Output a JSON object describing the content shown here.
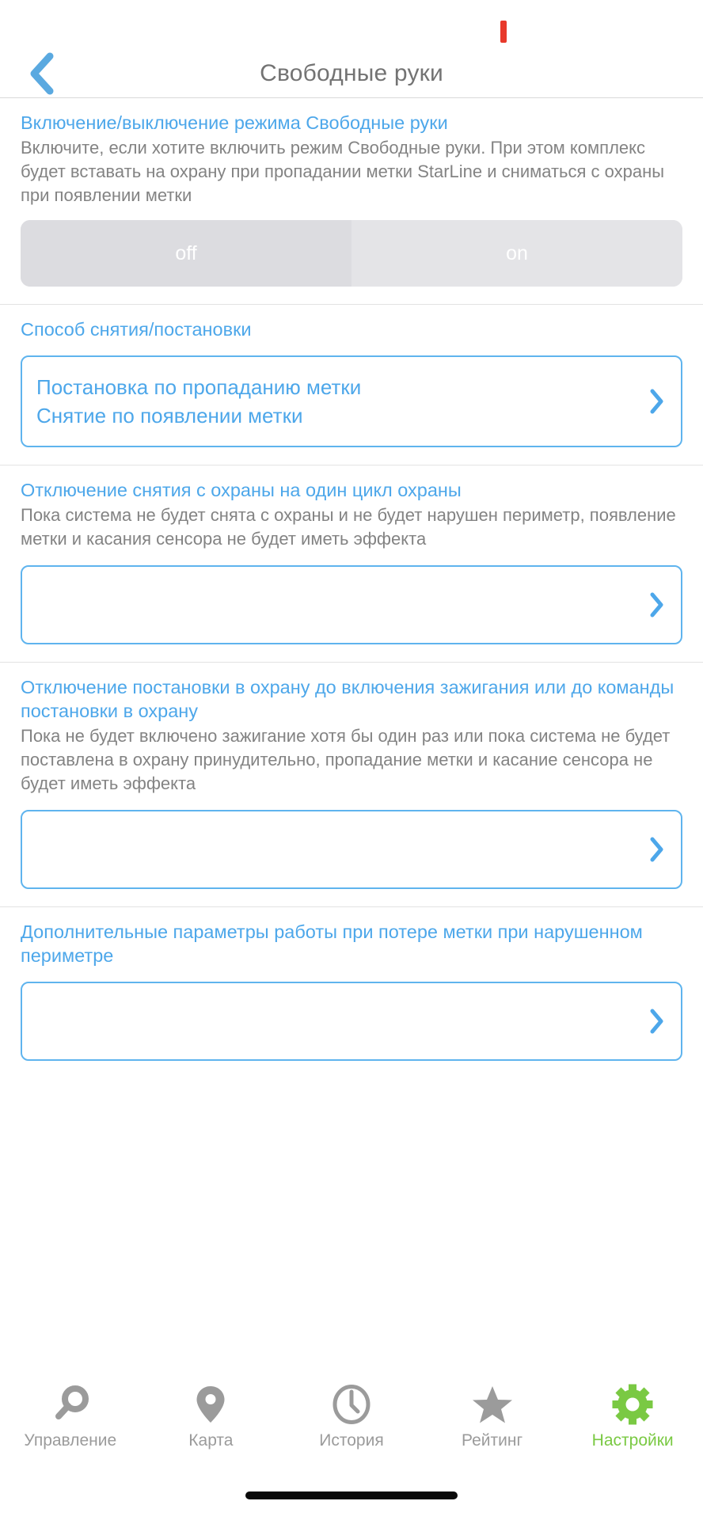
{
  "statusbar": {
    "indicator_color": "#e8392b"
  },
  "navbar": {
    "back_icon": "chevron-left-icon",
    "title": "Свободные руки",
    "accent": "#4da7ea"
  },
  "sections": [
    {
      "title": "Включение/выключение режима Свободные руки",
      "desc": "Включите, если хотите включить режим Свободные руки. При этом комплекс будет вставать на охрану при пропадании метки StarLine и сниматься с охраны при появлении метки",
      "control": "segmented",
      "segments": [
        {
          "label": "off",
          "selected": true
        },
        {
          "label": "on",
          "selected": false
        }
      ]
    },
    {
      "title": "Способ снятия/постановки",
      "desc": "",
      "control": "card",
      "card_lines": [
        "Постановка по пропаданию метки",
        "Снятие по появлении метки"
      ]
    },
    {
      "title": "Отключение снятия с охраны на один цикл охраны",
      "desc": "Пока система не будет снята с охраны и не будет нарушен периметр, появление метки и касания сенсора не будет иметь эффекта",
      "control": "card",
      "card_lines": []
    },
    {
      "title": "Отключение постановки в охрану до включения зажигания или до команды постановки в охрану",
      "desc": "Пока не будет включено зажигание хотя бы один раз или пока система не будет поставлена в охрану принудительно, пропадание метки и касание сенсора не будет иметь эффекта",
      "control": "card",
      "card_lines": []
    },
    {
      "title": "Дополнительные параметры работы при потере метки при нарушенном периметре",
      "desc": "",
      "control": "card",
      "card_lines": []
    }
  ],
  "tabbar": {
    "active_color": "#7ac943",
    "inactive_color": "#9b9b9b",
    "items": [
      {
        "label": "Управление",
        "icon": "key-icon",
        "active": false
      },
      {
        "label": "Карта",
        "icon": "map-pin-icon",
        "active": false
      },
      {
        "label": "История",
        "icon": "clock-icon",
        "active": false
      },
      {
        "label": "Рейтинг",
        "icon": "star-icon",
        "active": false
      },
      {
        "label": "Настройки",
        "icon": "gear-icon",
        "active": true
      }
    ]
  },
  "home_indicator": {
    "visible": true
  }
}
